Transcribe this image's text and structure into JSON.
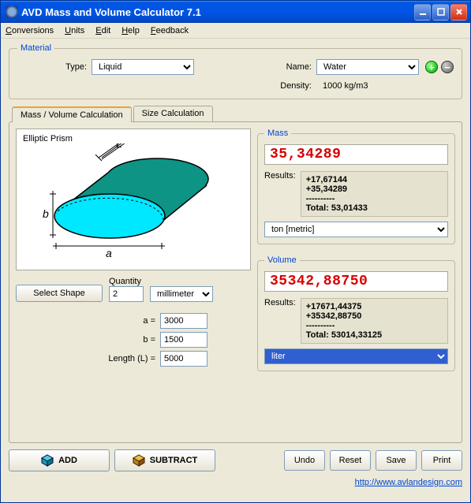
{
  "window": {
    "title": "AVD Mass and Volume Calculator 7.1"
  },
  "menu": {
    "conversions": "Conversions",
    "units": "Units",
    "edit": "Edit",
    "help": "Help",
    "feedback": "Feedback"
  },
  "material": {
    "legend": "Material",
    "type_label": "Type:",
    "type_value": "Liquid",
    "name_label": "Name:",
    "name_value": "Water",
    "density_label": "Density:",
    "density_value": "1000  kg/m3"
  },
  "tabs": {
    "mass_volume": "Mass / Volume  Calculation",
    "size": "Size  Calculation"
  },
  "shape": {
    "name": "Elliptic Prism",
    "select_button": "Select Shape",
    "quantity_label": "Quantity",
    "quantity_value": "2",
    "unit_value": "millimeter",
    "dim_a_label": "a =",
    "dim_a_value": "3000",
    "dim_b_label": "b =",
    "dim_b_value": "1500",
    "dim_len_label": "Length (L) =",
    "dim_len_value": "5000",
    "diagram_a": "a",
    "diagram_b": "b",
    "diagram_L": "L"
  },
  "mass": {
    "legend": "Mass",
    "value": "35,34289",
    "results_label": "Results:",
    "results_text": "+17,67144\n+35,34289\n----------\nTotal: 53,01433",
    "unit_value": "ton [metric]"
  },
  "volume": {
    "legend": "Volume",
    "value": "35342,88750",
    "results_label": "Results:",
    "results_text": "+17671,44375\n+35342,88750\n----------\nTotal: 53014,33125",
    "unit_value": "liter"
  },
  "buttons": {
    "add": "ADD",
    "subtract": "SUBTRACT",
    "undo": "Undo",
    "reset": "Reset",
    "save": "Save",
    "print": "Print"
  },
  "footer": {
    "link": "http://www.avlandesign.com"
  }
}
